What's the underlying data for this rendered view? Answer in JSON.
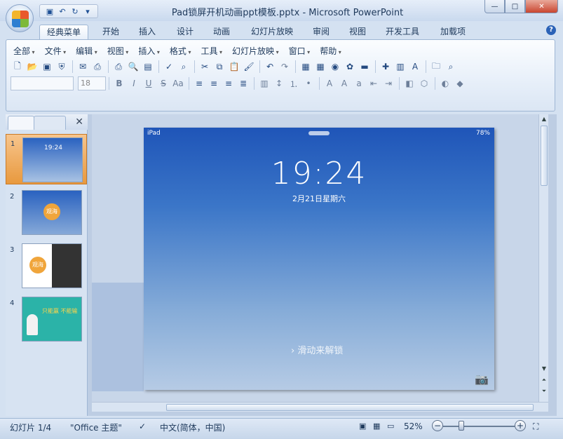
{
  "window": {
    "title": "Pad锁屏开机动画ppt模板.pptx - Microsoft PowerPoint",
    "min": "—",
    "max": "□",
    "close": "✕"
  },
  "tabs": [
    "经典菜单",
    "开始",
    "插入",
    "设计",
    "动画",
    "幻灯片放映",
    "审阅",
    "视图",
    "开发工具",
    "加载项"
  ],
  "menus": [
    "全部",
    "文件",
    "编辑",
    "视图",
    "插入",
    "格式",
    "工具",
    "幻灯片放映",
    "窗口",
    "帮助"
  ],
  "toolbar": {
    "font_size": "18"
  },
  "slides": [
    {
      "num": "1",
      "caption": "19:24"
    },
    {
      "num": "2",
      "caption": "观海"
    },
    {
      "num": "3",
      "caption": "观海"
    },
    {
      "num": "4",
      "caption": "只能赢 不能输"
    }
  ],
  "slide": {
    "status_left": "iPad",
    "battery": "78%",
    "time": "19:24",
    "date": "2月21日星期六",
    "unlock": "滑动来解锁",
    "camera_icon": "camera-icon"
  },
  "status": {
    "slide_indicator": "幻灯片 1/4",
    "theme": "\"Office 主题\"",
    "language": "中文(简体，中国)",
    "zoom": "52%"
  }
}
